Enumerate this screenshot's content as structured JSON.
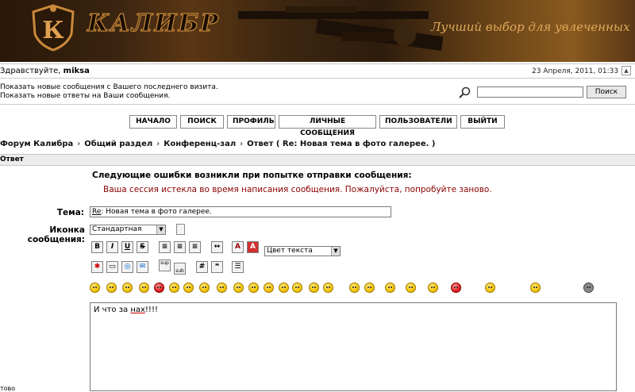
{
  "banner": {
    "brand": "КАЛИБР",
    "logo_letter": "К",
    "slogan": "Лучший выбор для увлеченных"
  },
  "header": {
    "greeting": "Здравствуйте,",
    "username": "miksa",
    "datetime": "23 Апреля, 2011, 01:33"
  },
  "links": [
    "Показать новые сообщения с Вашего последнего визита.",
    "Показать новые ответы на Ваши сообщения."
  ],
  "search": {
    "value": "",
    "button_label": "Поиск"
  },
  "nav": [
    "НАЧАЛО",
    "ПОИСК",
    "ПРОФИЛЬ",
    "ЛИЧНЫЕ СООБЩЕНИЯ",
    "ПОЛЬЗОВАТЕЛИ",
    "ВЫЙТИ"
  ],
  "breadcrumb": [
    "Форум Калибра",
    "Общий раздел",
    "Конференц-зал",
    "Ответ ( Re: Новая тема в фото галерее. )"
  ],
  "breadcrumb_sep": "›",
  "section_title": "Ответ",
  "errors": {
    "title": "Следующие ошибки возникли при попытке отправки сообщения:",
    "message": "Ваша сессия истекла во время написания сообщения. Пожалуйста, попробуйте заново."
  },
  "form": {
    "subject_label": "Тема:",
    "subject_prefix": "Re",
    "subject_rest": ": Новая тема в фото галерее.",
    "icon_label": "Иконка сообщения:",
    "icon_value": "Стандартная",
    "color_value": "Цвет текста",
    "message_before": "И что за ",
    "message_underlined": "нах",
    "message_after": "!!!!"
  },
  "toolbar": {
    "bold": "B",
    "italic": "I",
    "underline": "U",
    "strike": "S",
    "sup": "sup",
    "sub": "sub",
    "hash": "#"
  },
  "footer_word": "тово"
}
